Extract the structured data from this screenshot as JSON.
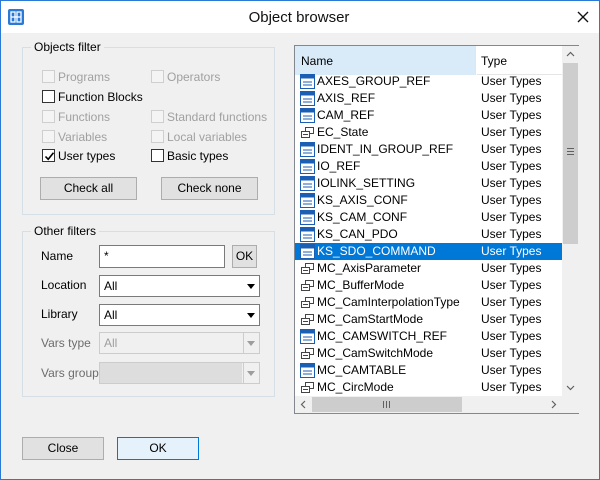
{
  "window": {
    "title": "Object browser"
  },
  "objects_filter": {
    "title": "Objects filter",
    "programs": "Programs",
    "operators": "Operators",
    "function_blocks": "Function Blocks",
    "functions": "Functions",
    "standard_functions": "Standard functions",
    "variables": "Variables",
    "local_variables": "Local variables",
    "user_types": "User types",
    "basic_types": "Basic types",
    "check_all": "Check all",
    "check_none": "Check none"
  },
  "other_filters": {
    "title": "Other filters",
    "name_label": "Name",
    "name_value": "*",
    "ok_label": "OK",
    "location_label": "Location",
    "location_value": "All",
    "library_label": "Library",
    "library_value": "All",
    "vars_type_label": "Vars type",
    "vars_type_value": "All",
    "vars_group_label": "Vars group",
    "vars_group_value": ""
  },
  "list": {
    "col_name": "Name",
    "col_type": "Type",
    "rows": [
      {
        "name": "AXES_GROUP_REF",
        "type": "User Types",
        "icon": "struct-icon"
      },
      {
        "name": "AXIS_REF",
        "type": "User Types",
        "icon": "struct-icon"
      },
      {
        "name": "CAM_REF",
        "type": "User Types",
        "icon": "struct-icon"
      },
      {
        "name": "EC_State",
        "type": "User Types",
        "icon": "enum-icon"
      },
      {
        "name": "IDENT_IN_GROUP_REF",
        "type": "User Types",
        "icon": "struct-icon"
      },
      {
        "name": "IO_REF",
        "type": "User Types",
        "icon": "struct-icon"
      },
      {
        "name": "IOLINK_SETTING",
        "type": "User Types",
        "icon": "struct-icon"
      },
      {
        "name": "KS_AXIS_CONF",
        "type": "User Types",
        "icon": "struct-icon"
      },
      {
        "name": "KS_CAM_CONF",
        "type": "User Types",
        "icon": "struct-icon"
      },
      {
        "name": "KS_CAN_PDO",
        "type": "User Types",
        "icon": "struct-icon"
      },
      {
        "name": "KS_SDO_COMMAND",
        "type": "User Types",
        "icon": "struct-icon"
      },
      {
        "name": "MC_AxisParameter",
        "type": "User Types",
        "icon": "enum-icon"
      },
      {
        "name": "MC_BufferMode",
        "type": "User Types",
        "icon": "enum-icon"
      },
      {
        "name": "MC_CamInterpolationType",
        "type": "User Types",
        "icon": "enum-icon"
      },
      {
        "name": "MC_CamStartMode",
        "type": "User Types",
        "icon": "enum-icon"
      },
      {
        "name": "MC_CAMSWITCH_REF",
        "type": "User Types",
        "icon": "struct-icon"
      },
      {
        "name": "MC_CamSwitchMode",
        "type": "User Types",
        "icon": "enum-icon"
      },
      {
        "name": "MC_CAMTABLE",
        "type": "User Types",
        "icon": "struct-icon"
      },
      {
        "name": "MC_CircMode",
        "type": "User Types",
        "icon": "enum-icon"
      }
    ]
  },
  "footer": {
    "close_label": "Close",
    "ok_label": "OK"
  },
  "colors": {
    "accent": "#0078d7",
    "header_bg": "#d9ebf9",
    "dialog_bg": "#f0f0f0"
  }
}
